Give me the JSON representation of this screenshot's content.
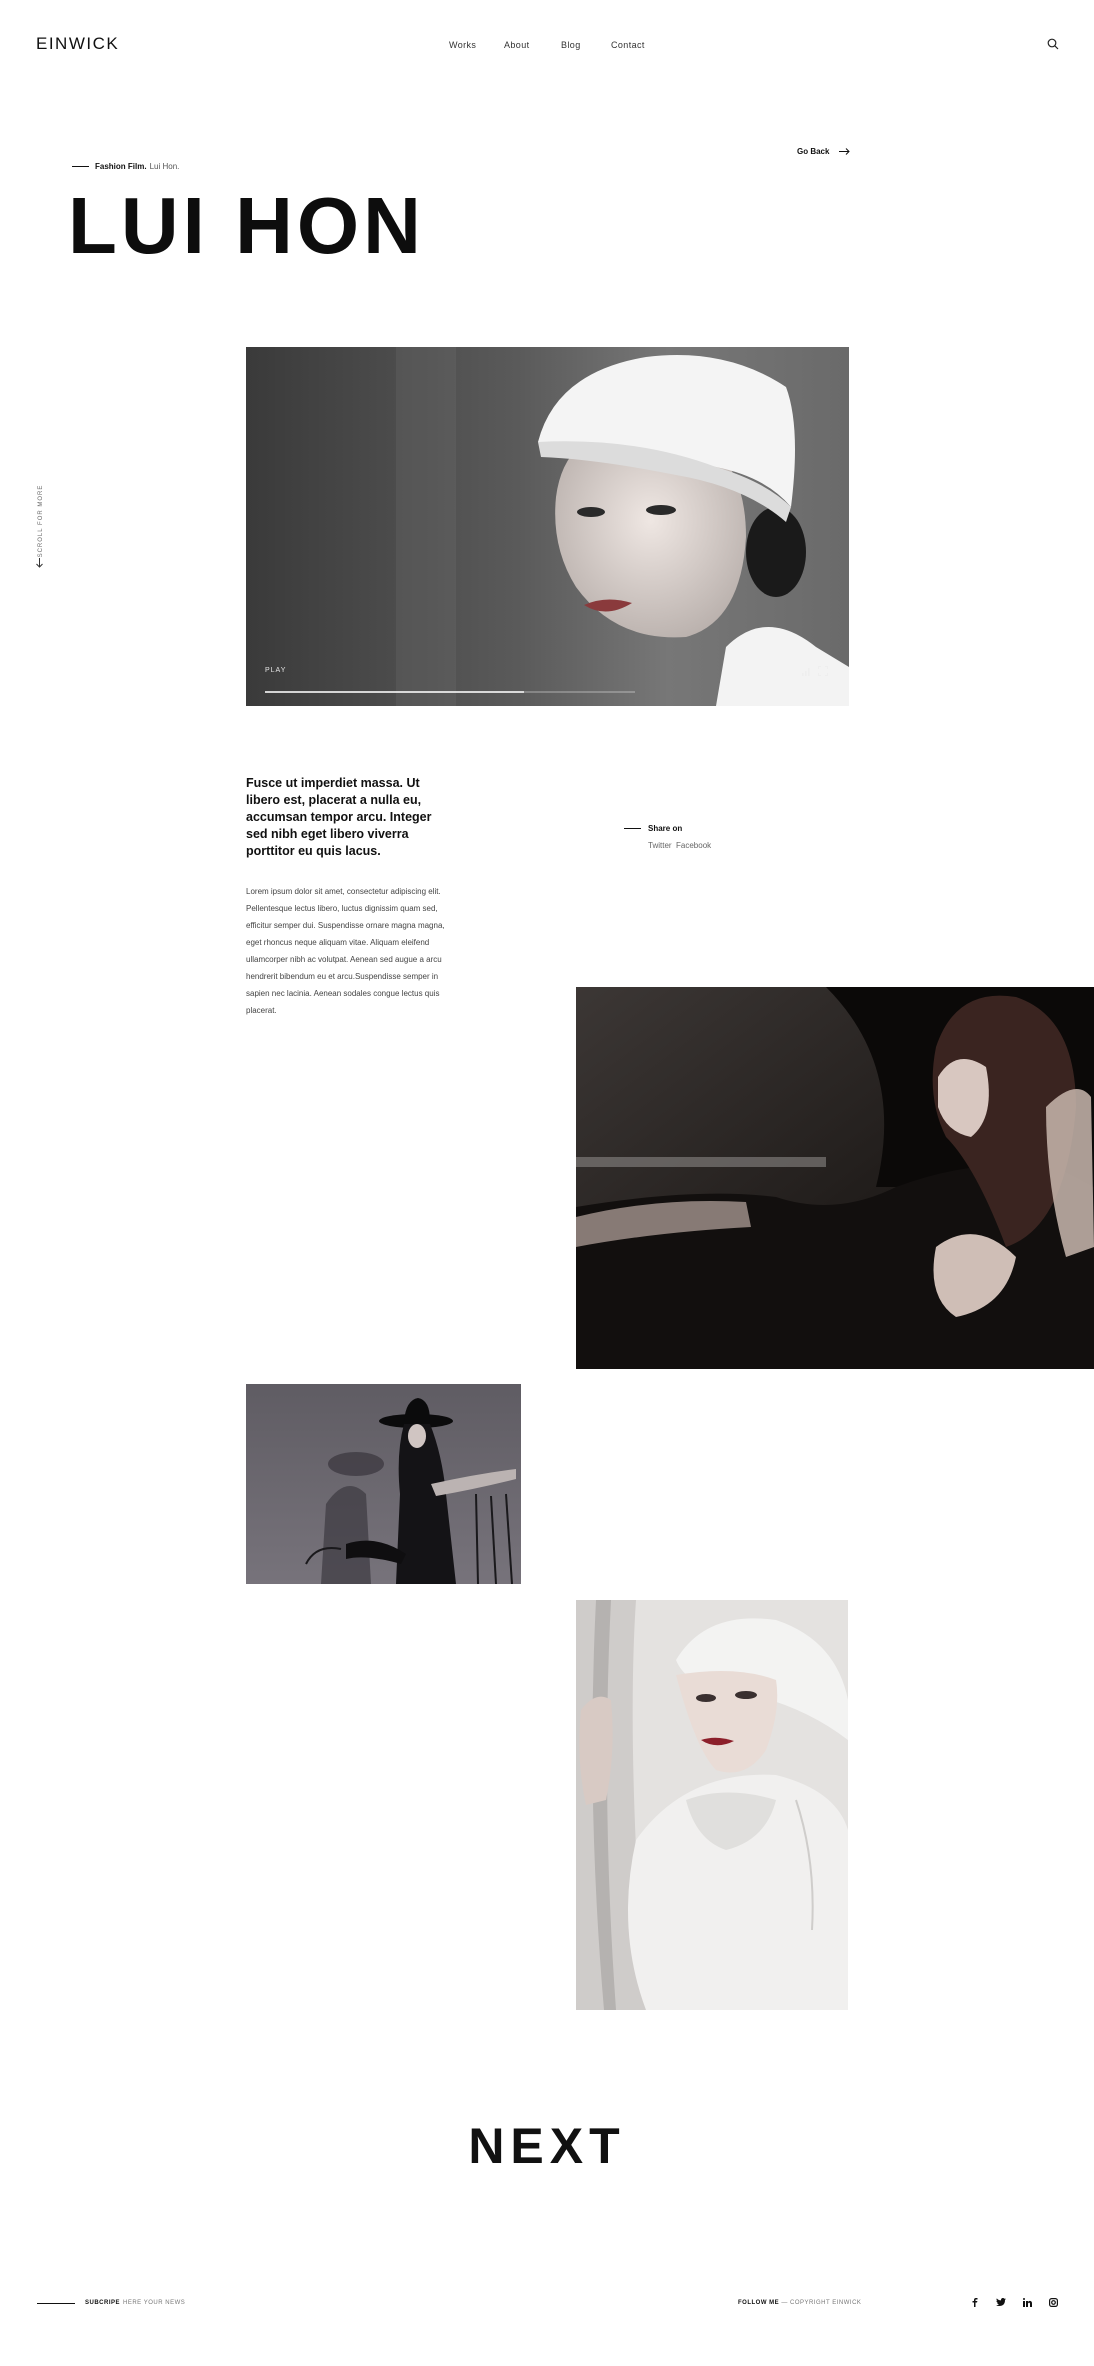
{
  "header": {
    "logo": "EINWICK",
    "nav": [
      {
        "label": "Works"
      },
      {
        "label": "About"
      },
      {
        "label": "Blog"
      },
      {
        "label": "Contact"
      }
    ],
    "search_icon": "search-icon"
  },
  "project": {
    "category": "Fashion Film.",
    "name": "Lui Hon.",
    "title": "LUI HON",
    "go_back": "Go Back"
  },
  "scroll_hint": "SCROLL FOR MORE",
  "video": {
    "play_label": "PLAY",
    "progress": 0.7,
    "controls": [
      "volume-icon",
      "fullscreen-icon"
    ]
  },
  "content": {
    "lead": "Fusce ut imperdiet massa. Ut libero est, placerat a nulla eu, accumsan tempor arcu. Integer sed nibh eget libero viverra porttitor eu quis lacus.",
    "body": "Lorem ipsum dolor sit amet, consectetur adipiscing elit. Pellentesque lectus libero, luctus dignissim quam sed, efficitur semper dui. Suspendisse ornare magna magna, eget rhoncus neque aliquam vitae. Aliquam eleifend ullamcorper nibh ac volutpat. Aenean sed augue a arcu hendrerit bibendum eu et arcu.Suspendisse semper in sapien nec lacinia. Aenean sodales congue lectus quis placerat."
  },
  "share": {
    "label": "Share on",
    "links": [
      "Twitter",
      "Facebook"
    ]
  },
  "next_label": "NEXT",
  "footer": {
    "subscribe": "SUBCRIPE",
    "subscribe_hint": "HERE YOUR NEWS",
    "follow": "FOLLOW ME",
    "copyright": "— COPYRIGHT EINWICK",
    "social_icons": [
      "facebook-icon",
      "twitter-icon",
      "linkedin-icon",
      "instagram-icon"
    ]
  },
  "colors": {
    "text": "#111111",
    "background": "#ffffff",
    "muted": "#777777"
  }
}
